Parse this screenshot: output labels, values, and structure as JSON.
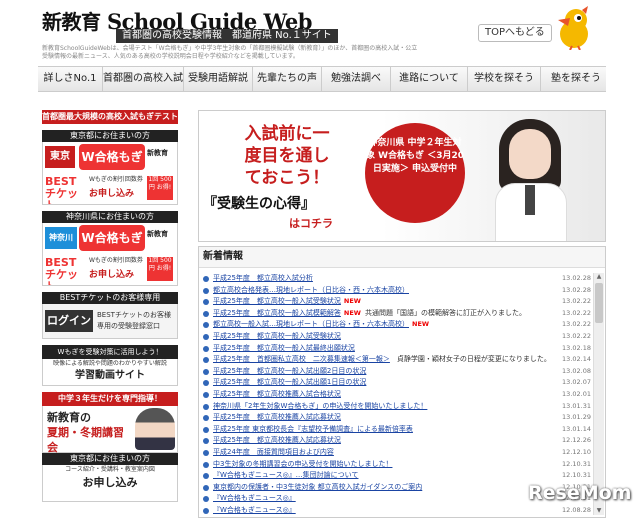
{
  "header": {
    "logo_prefix": "新教育",
    "logo_main": "School Guide Web",
    "tagline": "首都圏の高校受験情報　都道府県 No.１サイト",
    "top_button": "TOPへもどる",
    "description": "新教育SchoolGuideWebは、会場テスト「W合格もぎ」や中学3年生対象の「首都圏模擬試験（新教育）」のほか、首都圏の高校入試・公立受験情報の最新ニュース、人気のある高校の学校説明会日程や学校紹介などを掲載しています。"
  },
  "nav": [
    "詳しさNo.1",
    "首都圏の高校入試",
    "受験用語解説",
    "先輩たちの声",
    "勉強法調べ",
    "進路について",
    "学校を探そう",
    "塾を探そう"
  ],
  "sidebar": {
    "top_banner": "首都圏最大規模の高校入試もぎテスト",
    "tokyo": {
      "header": "東京都にお住まいの方",
      "pref": "東京",
      "w_label": "W合格もぎ",
      "brand": "新教育",
      "best": "BEST チケット",
      "sub": "Wもぎの割引回数券",
      "apply": "お申し込み",
      "price": "1回 500円 お得!"
    },
    "kanagawa": {
      "header": "神奈川県にお住まいの方",
      "pref": "神奈川",
      "w_label": "W合格もぎ",
      "brand": "新教育",
      "best": "BEST チケット",
      "sub": "Wもぎの割引回数券",
      "apply": "お申し込み",
      "price": "1回 500円 お得!"
    },
    "login": {
      "header": "BESTチケットのお客様専用",
      "button": "ログイン",
      "text": "BESTチケットのお客様専用の受験登録窓口"
    },
    "video": {
      "header": "Wもぎを受験対策に活用しよう！",
      "line1": "映像による解説や問題のわかりやすい解説",
      "line2": "学習動画サイト"
    },
    "course": {
      "header": "中学３年生だけを専門指導！",
      "title_brand": "新教育の",
      "title_main": "夏期・冬期講習会",
      "sub_header": "東京都にお住まいの方",
      "sub": "コース紹介・受講料・教室案内図",
      "apply": "お申し込み"
    }
  },
  "hero": {
    "headline": "入試前に一度目を通しておこう！",
    "sub": "『受験生の心得』",
    "link": "はコチラ",
    "circle": "神奈川県 中学２年生対象 W合格もぎ ＜3月20日実施＞ 申込受付中"
  },
  "news": {
    "title": "新着情報",
    "items": [
      {
        "text": "平成25年度　都立高校入試分析",
        "date": "13.02.28",
        "new": "",
        "note": ""
      },
      {
        "text": "都立高校合格発表…現地レポート（日比谷・西・六本木高校）",
        "date": "13.02.28",
        "new": "",
        "note": ""
      },
      {
        "text": "平成25年度　都立高校一般入試受験状況",
        "date": "13.02.22",
        "new": "NEW",
        "note": ""
      },
      {
        "text": "平成25年度　都立高校一般入試模範解答",
        "date": "13.02.22",
        "new": "NEW",
        "note": "共通問題「国語」の模範解答に訂正が入りました。"
      },
      {
        "text": "都立高校一般入試…現地レポート（日比谷・西・六本木高校）",
        "date": "13.02.22",
        "new": "NEW",
        "note": ""
      },
      {
        "text": "平成25年度　都立高校一般入試受験状況",
        "date": "13.02.22",
        "new": "",
        "note": ""
      },
      {
        "text": "平成25年度　都立高校一般入試最終出願状況",
        "date": "13.02.18",
        "new": "",
        "note": ""
      },
      {
        "text": "平成25年度　首都圏私立高校　二次募集速報＜第一報＞",
        "date": "13.02.14",
        "new": "",
        "note": "貞静学園・穎材女子の日程が変更になりました。"
      },
      {
        "text": "平成25年度　都立高校一般入試出願2日目の状況",
        "date": "13.02.08",
        "new": "",
        "note": ""
      },
      {
        "text": "平成25年度　都立高校一般入試出願1日目の状況",
        "date": "13.02.07",
        "new": "",
        "note": ""
      },
      {
        "text": "平成25年度　都立高校推薦入試合格状況",
        "date": "13.02.01",
        "new": "",
        "note": ""
      },
      {
        "text": "神奈川県「2年生対象W合格もぎ」の申込受付を開始いたしました！",
        "date": "13.01.31",
        "new": "",
        "note": ""
      },
      {
        "text": "平成25年度　都立高校推薦入試応募状況",
        "date": "13.01.29",
        "new": "",
        "note": ""
      },
      {
        "text": "平成25年度 東京都校長会『志望校予備調査』による最新倍率表",
        "date": "13.01.14",
        "new": "",
        "note": ""
      },
      {
        "text": "平成25年度　都立高校推薦入試応募状況",
        "date": "12.12.26",
        "new": "",
        "note": ""
      },
      {
        "text": "平成24年度　面接質問項目および内容",
        "date": "12.12.10",
        "new": "",
        "note": ""
      },
      {
        "text": "中3生対象の冬期講習会の申込受付を開始いたしました！",
        "date": "12.10.31",
        "new": "",
        "note": ""
      },
      {
        "text": "『W合格もぎニュース◎』…集団討論について",
        "date": "12.10.31",
        "new": "",
        "note": ""
      },
      {
        "text": "東京都内の保護者・中3生徒対象 都立高校入試ガイダンスのご案内",
        "date": "12.10.31",
        "new": "",
        "note": ""
      },
      {
        "text": "『W合格もぎニュース◎』",
        "date": "12.10.01",
        "new": "",
        "note": ""
      },
      {
        "text": "『W合格もぎニュース◎』",
        "date": "12.08.28",
        "new": "",
        "note": ""
      }
    ]
  },
  "watermark": "ReseMom"
}
